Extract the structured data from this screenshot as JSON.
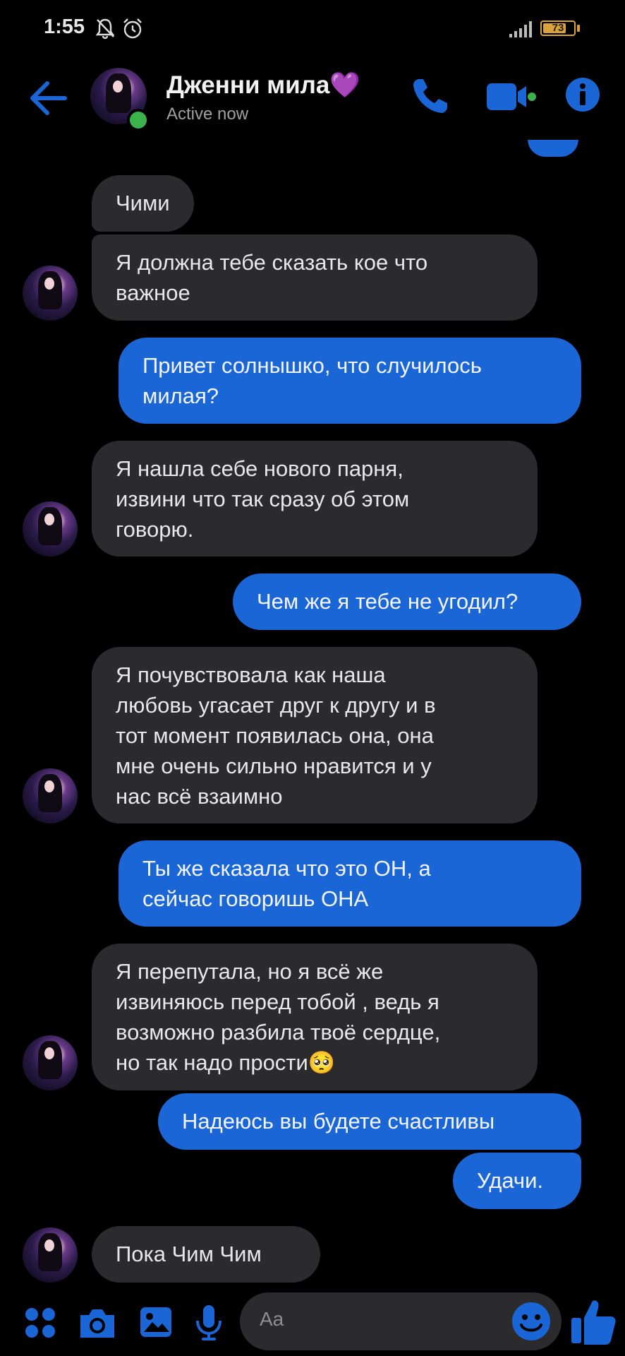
{
  "status_bar": {
    "time": "1:55",
    "battery": "73"
  },
  "header": {
    "contact_name": "Дженни мила",
    "heart": "💜",
    "presence": "Active now"
  },
  "messages": [
    {
      "side": "received",
      "lines": [
        "Чими"
      ]
    },
    {
      "side": "received",
      "lines": [
        "Я должна тебе сказать кое что",
        "важное"
      ]
    },
    {
      "side": "sent",
      "lines": [
        "Привет солнышко, что случилось",
        "милая?"
      ]
    },
    {
      "side": "received",
      "lines": [
        "Я нашла себе нового парня,",
        "извини что так сразу об этом",
        "говорю."
      ]
    },
    {
      "side": "sent",
      "lines": [
        "Чем же я тебе не угодил?"
      ]
    },
    {
      "side": "received",
      "lines": [
        "Я почувствовала как наша",
        "любовь угасает друг к другу и в",
        "тот момент появилась она, она",
        "мне очень сильно нравится и у",
        "нас всё взаимно"
      ]
    },
    {
      "side": "sent",
      "lines": [
        "Ты же сказала что это ОН, а",
        "сейчас говоришь ОНА"
      ]
    },
    {
      "side": "received",
      "lines": [
        "Я перепутала, но я всё же",
        "извиняюсь перед тобой , ведь я",
        "возможно разбила твоё сердце,",
        "но так надо прости🥺"
      ]
    },
    {
      "side": "sent",
      "lines": [
        "Надеюсь вы будете счастливы"
      ]
    },
    {
      "side": "sent",
      "lines": [
        "Удачи."
      ]
    },
    {
      "side": "received",
      "lines": [
        "Пока Чим Чим"
      ]
    }
  ],
  "composer": {
    "placeholder": "Aa"
  },
  "colors": {
    "accent": "#1b66d6",
    "received_bubble": "#2b2b2e",
    "online": "#3bb34a"
  },
  "icons": [
    "back-arrow-icon",
    "phone-icon",
    "video-camera-icon",
    "info-icon",
    "apps-icon",
    "camera-icon",
    "gallery-icon",
    "microphone-icon",
    "emoji-icon",
    "thumbs-up-icon"
  ]
}
